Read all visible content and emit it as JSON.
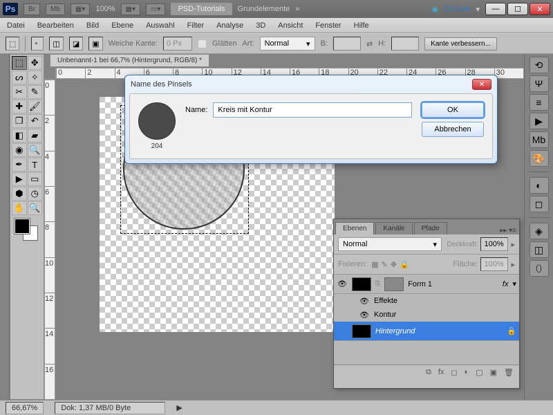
{
  "titlebar": {
    "zoom_pct": "100%",
    "workspace": "PSD-Tutorials",
    "workspace2": "Grundelemente",
    "cs_live": "CS Live"
  },
  "menu": {
    "datei": "Datei",
    "bearbeiten": "Bearbeiten",
    "bild": "Bild",
    "ebene": "Ebene",
    "auswahl": "Auswahl",
    "filter": "Filter",
    "analyse": "Analyse",
    "dreid": "3D",
    "ansicht": "Ansicht",
    "fenster": "Fenster",
    "hilfe": "Hilfe"
  },
  "options": {
    "weiche_kante": "Weiche Kante:",
    "weiche_kante_val": "0 Px",
    "glaetten": "Glätten",
    "art": "Art:",
    "art_val": "Normal",
    "b": "B:",
    "h": "H:",
    "kante_btn": "Kante verbessern..."
  },
  "document": {
    "tab": "Unbenannt-1 bei 66,7% (Hintergrund, RGB/8) *"
  },
  "rulers": {
    "h": [
      "0",
      "2",
      "4",
      "6",
      "8",
      "10",
      "12",
      "14",
      "16",
      "18",
      "20",
      "22",
      "24",
      "26",
      "28",
      "30"
    ],
    "v": [
      "0",
      "2",
      "4",
      "6",
      "8",
      "10",
      "12",
      "14",
      "16"
    ]
  },
  "dialog": {
    "title": "Name des Pinsels",
    "brush_size": "204",
    "name_label": "Name:",
    "name_value": "Kreis mit Kontur",
    "ok": "OK",
    "cancel": "Abbrechen"
  },
  "layers": {
    "tabs": {
      "ebenen": "Ebenen",
      "kanaele": "Kanäle",
      "pfade": "Pfade"
    },
    "blend": "Normal",
    "deckkraft_label": "Deckkraft:",
    "deckkraft": "100%",
    "fixieren": "Fixieren:",
    "flaeche_label": "Fläche:",
    "flaeche": "100%",
    "items": {
      "form1": "Form 1",
      "effekte": "Effekte",
      "kontur": "Kontur",
      "hintergrund": "Hintergrund"
    },
    "fx": "fx"
  },
  "status": {
    "zoom": "66,67%",
    "dok": "Dok: 1,37 MB/0 Byte"
  }
}
